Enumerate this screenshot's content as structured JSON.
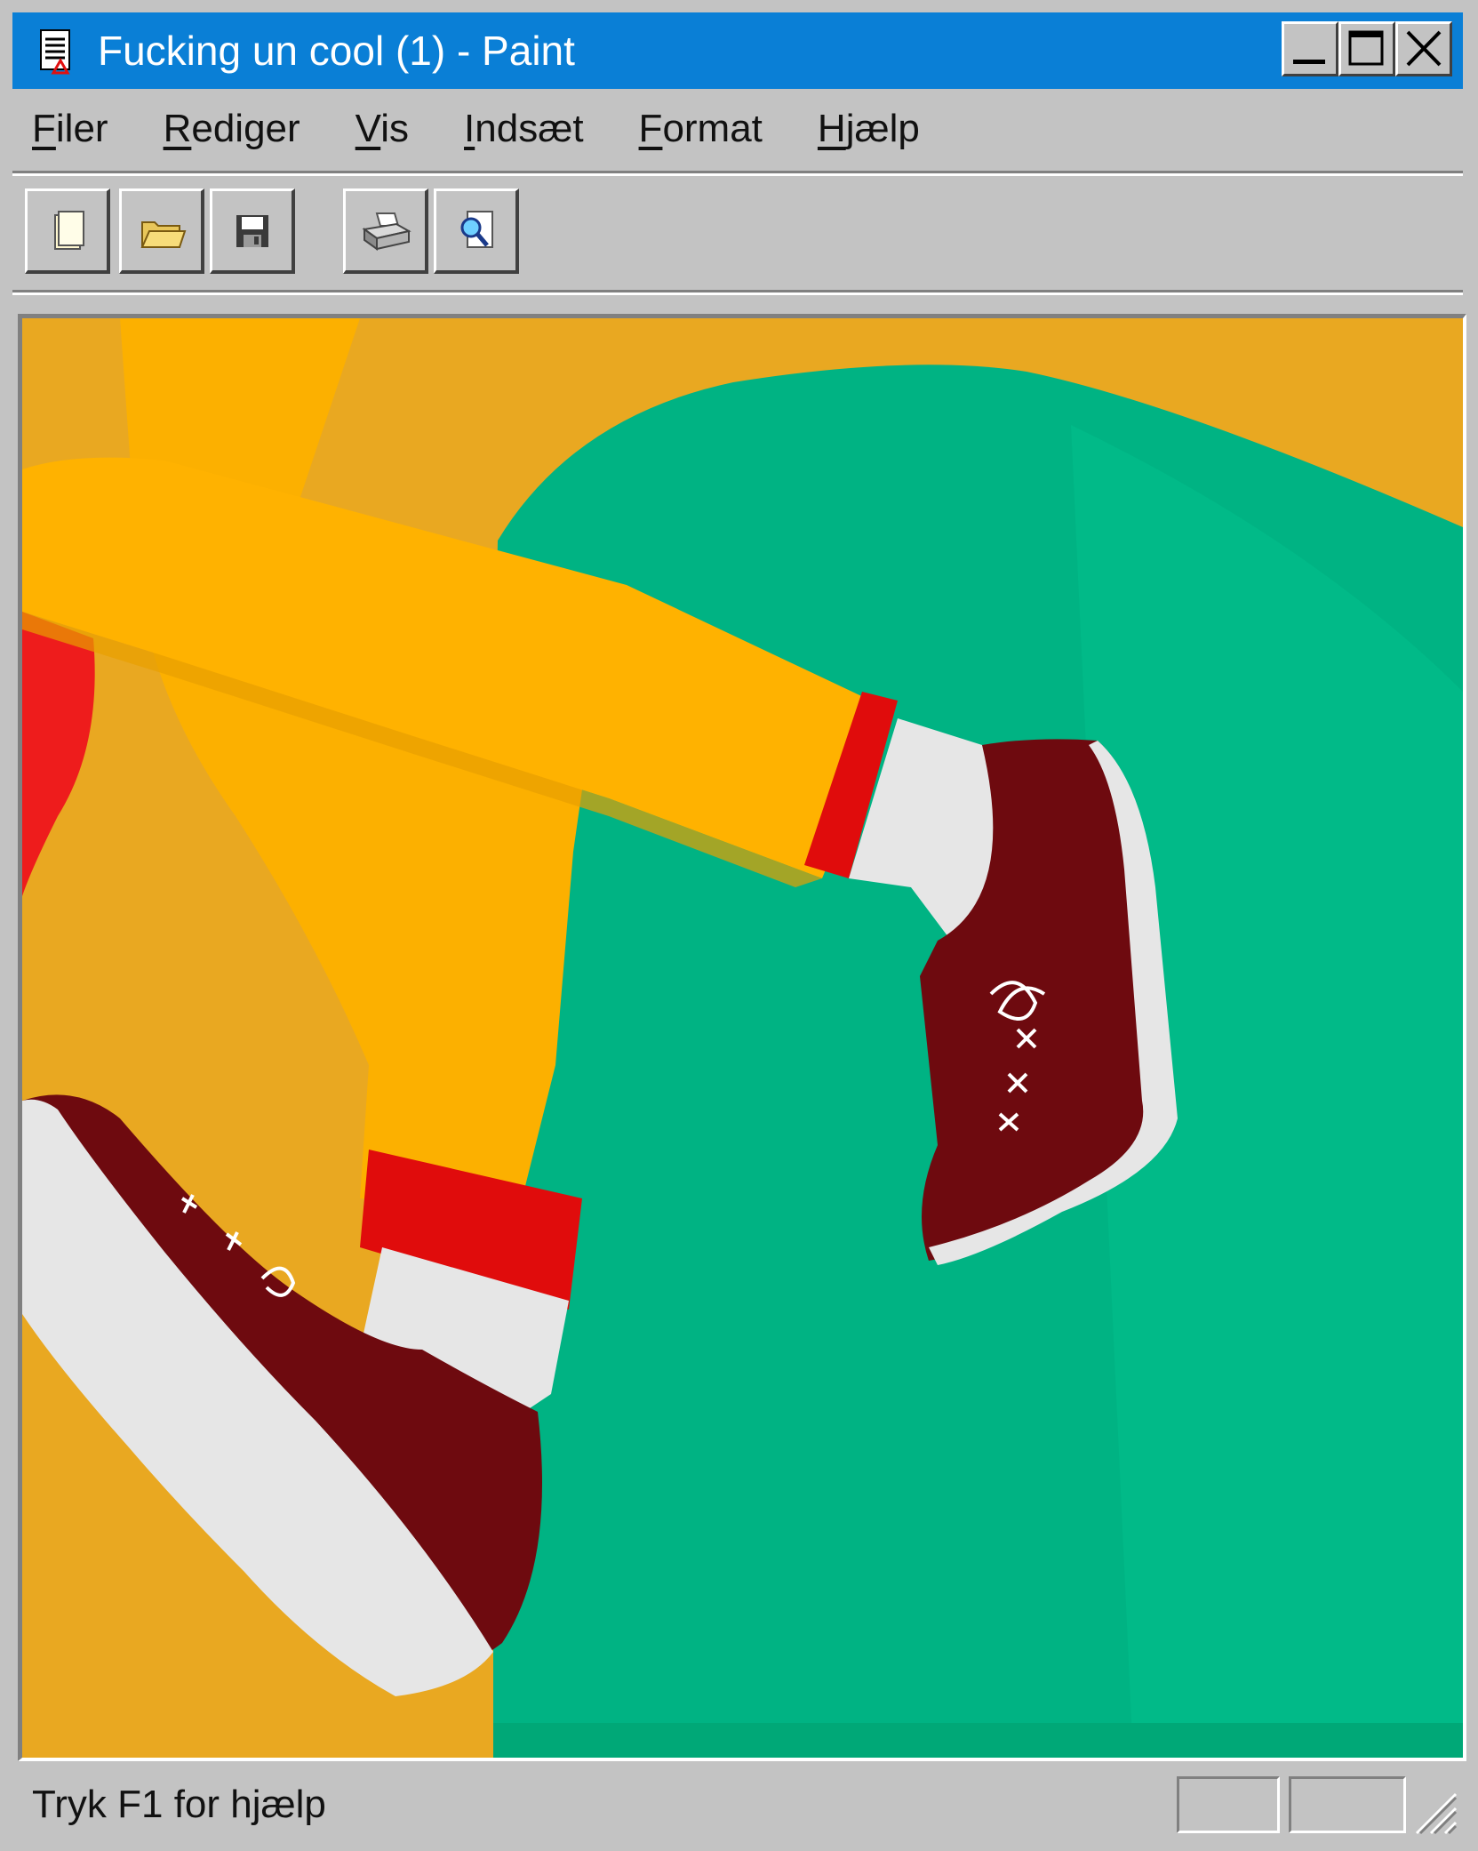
{
  "window": {
    "title": "Fucking un cool (1) - Paint"
  },
  "menu": [
    {
      "accel": "F",
      "rest": "iler"
    },
    {
      "accel": "R",
      "rest": "ediger"
    },
    {
      "accel": "V",
      "rest": "is"
    },
    {
      "accel": "I",
      "rest": "ndsæt"
    },
    {
      "accel": "F",
      "rest": "ormat"
    },
    {
      "accel": "H",
      "rest": "jælp"
    }
  ],
  "toolbar": {
    "icons": [
      "new-document-icon",
      "open-folder-icon",
      "save-floppy-icon",
      "print-icon",
      "print-preview-icon"
    ]
  },
  "canvas": {
    "colors": {
      "background_orange": "#e9a821",
      "leg_yellow": "#fcb000",
      "green": "#00b383",
      "red": "#ee1c1c",
      "shoe": "#6e0a0f",
      "sock": "#e6e6e6"
    }
  },
  "status": {
    "text": "Tryk F1 for hjælp"
  }
}
